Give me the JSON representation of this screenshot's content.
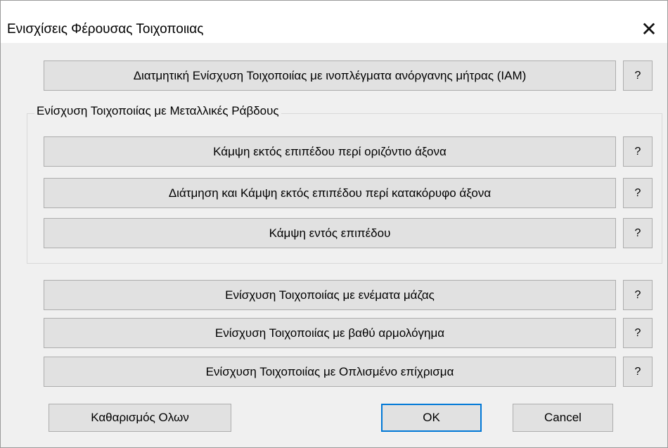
{
  "dialog": {
    "title": "Ενισχίσεις Φέρουσας Τοιχοποιιας",
    "close_glyph": "✕"
  },
  "top_button": {
    "label": "Διατμητική Ενίσχυση Τοιχοποιίας με ινοπλέγματα ανόργανης μήτρας (ΙΑΜ)",
    "help": "?"
  },
  "group": {
    "label": "Ενίσχυση Τοιχοποιίας με Μεταλλικές Ράβδους",
    "buttons": [
      {
        "label": "Κάμψη εκτός επιπέδου περί οριζόντιο άξονα",
        "help": "?"
      },
      {
        "label": "Διάτμηση και Κάμψη εκτός επιπέδου περί κατακόρυφο άξονα",
        "help": "?"
      },
      {
        "label": "Κάμψη εντός επιπέδου",
        "help": "?"
      }
    ]
  },
  "lower_buttons": [
    {
      "label": "Ενίσχυση Τοιχοποιίας με ενέματα μάζας",
      "help": "?"
    },
    {
      "label": "Ενίσχυση Τοιχοποιίας με βαθύ αρμολόγημα",
      "help": "?"
    },
    {
      "label": "Ενίσχυση Τοιχοποιίας με Οπλισμένο επίχρισμα",
      "help": "?"
    }
  ],
  "footer": {
    "clear_all": "Καθαρισμός Ολων",
    "ok": "OK",
    "cancel": "Cancel"
  },
  "colors": {
    "dialog_bg": "#f0f0f0",
    "button_bg": "#e1e1e1",
    "button_border": "#adadad",
    "focus_border": "#0078d7"
  }
}
